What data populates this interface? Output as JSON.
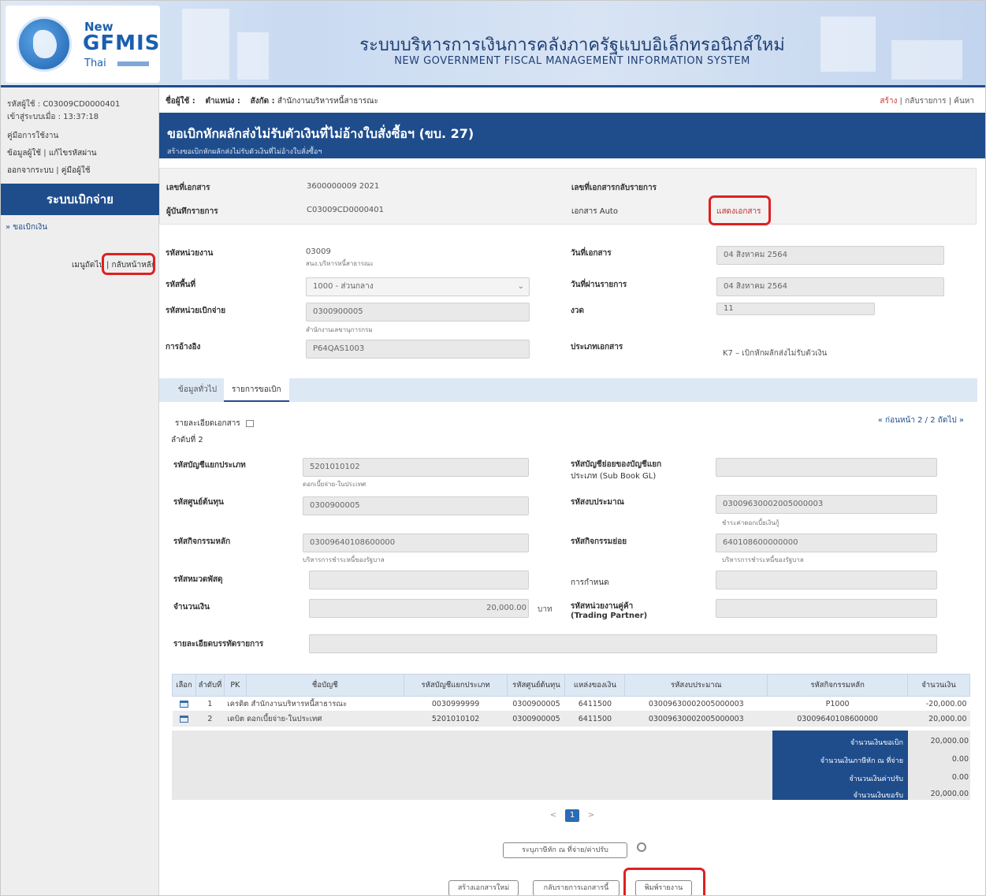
{
  "header": {
    "logo_new": "New",
    "logo_name": "GFMIS",
    "logo_thai": "Thai",
    "title_th": "ระบบบริหารการเงินการคลังภาครัฐแบบอิเล็กทรอนิกส์ใหม่",
    "title_en": "NEW GOVERNMENT FISCAL MANAGEMENT INFORMATION SYSTEM"
  },
  "sidebar": {
    "user_code": "รหัสผู้ใช้ : C03009CD0000401",
    "login_time": "เข้าสู่ระบบเมื่อ : 13:37:18",
    "manual": "คู่มือการใช้งาน",
    "user_info": "ข้อมูลผู้ใช้",
    "change_password": "แก้ไขรหัสผ่าน",
    "logout": "ออกจากระบบ",
    "user_manual": "คู่มือผู้ใช้",
    "system_name": "ระบบเบิกจ่าย",
    "menu_item": "» ขอเบิกเงิน",
    "nav_menu": "เมนูถัดไป",
    "nav_home": "กลับหน้าหลัก"
  },
  "topbar": {
    "user_label": "ชื่อผู้ใช้ :",
    "position_label": "ตำแหน่ง :",
    "affiliation_label": "สังกัด :",
    "affiliation_value": "สำนักงานบริหารหนี้สาธารณะ",
    "link_create": "สร้าง",
    "link_list": "กลับรายการ",
    "link_search": "ค้นหา"
  },
  "page": {
    "title": "ขอเบิกหักผลักส่งไม่รับตัวเงินที่ไม่อ้างใบสั่งซื้อฯ (ขบ. 27)",
    "subtitle": "สร้างขอเบิกหักผลักส่งไม่รับตัวเงินที่ไม่อ้างใบสั่งซื้อฯ"
  },
  "doc": {
    "doc_no_label": "เลขที่เอกสาร",
    "doc_no_value": "3600000009   2021",
    "recorder_label": "ผู้บันทึกรายการ",
    "recorder_value": "C03009CD0000401",
    "ref_doc_label": "เลขที่เอกสารกลับรายการ",
    "auto_doc_label": "เอกสาร Auto",
    "auto_doc_link": "แสดงเอกสาร"
  },
  "form": {
    "agency_label": "รหัสหน่วยงาน",
    "agency_value": "03009",
    "agency_sub": "สนง.บริหารหนี้สาธารณะ",
    "area_label": "รหัสพื้นที่",
    "area_value": "1000 - ส่วนกลาง",
    "disb_unit_label": "รหัสหน่วยเบิกจ่าย",
    "disb_unit_value": "0300900005",
    "disb_unit_sub": "สำนักงานเลขานุการกรม",
    "reference_label": "การอ้างอิง",
    "reference_value": "P64QAS1003",
    "doc_date_label": "วันที่เอกสาร",
    "doc_date_value": "04 สิงหาคม 2564",
    "post_date_label": "วันที่ผ่านรายการ",
    "post_date_value": "04 สิงหาคม 2564",
    "period_label": "งวด",
    "period_value": "11",
    "doc_type_label": "ประเภทเอกสาร",
    "doc_type_value": "K7 – เบิกหักผลักส่งไม่รับตัวเงิน"
  },
  "tabs": [
    "ข้อมูลทั่วไป",
    "รายการขอเบิก"
  ],
  "detail": {
    "header": "รายละเอียดเอกสาร",
    "pager": "« ก่อนหน้า 2 / 2 ถัดไป »",
    "item_no": "ลำดับที่ 2",
    "gl_label": "รหัสบัญชีแยกประเภท",
    "gl_value": "5201010102",
    "gl_sub": "ดอกเบี้ยจ่าย-ในประเทศ",
    "subgl_label": "รหัสบัญชีย่อยของบัญชีแยกประเภท (Sub Book GL)",
    "subgl_label1": "รหัสบัญชีย่อยของบัญชีแยก",
    "subgl_label2": "ประเภท (Sub Book GL)",
    "cost_center_label": "รหัสศูนย์ต้นทุน",
    "cost_center_value": "0300900005",
    "budget_label": "รหัสงบประมาณ",
    "budget_value": "03009630002005000003",
    "budget_sub": "ชำระค่าดอกเบี้ยเงินกู้",
    "main_activity_label": "รหัสกิจกรรมหลัก",
    "main_activity_value": "03009640108600000",
    "main_activity_sub": "บริหารการชำระหนี้ของรัฐบาล",
    "sub_activity_label": "รหัสกิจกรรมย่อย",
    "sub_activity_value": "640108600000000",
    "sub_activity_sub": "บริหารการชำระหนี้ของรัฐบาล",
    "asset_label": "รหัสหมวดพัสดุ",
    "designation_label": "การกำหนด",
    "amount_label": "จำนวนเงิน",
    "amount_value": "20,000.00",
    "amount_unit": "บาท",
    "trading_label1": "รหัสหน่วยงานคู่ค้า",
    "trading_label2": "(Trading Partner)",
    "desc_label": "รายละเอียดบรรทัดรายการ"
  },
  "table": {
    "columns": [
      "เลือก",
      "ลำดับที่",
      "PK",
      "ชื่อบัญชี",
      "รหัสบัญชีแยกประเภท",
      "รหัสศูนย์ต้นทุน",
      "แหล่งของเงิน",
      "รหัสงบประมาณ",
      "รหัสกิจกรรมหลัก",
      "จำนวนเงิน"
    ],
    "rows": [
      {
        "no": "1",
        "pk": "เครดิต",
        "account": "สำนักงานบริหารหนี้สาธารณะ",
        "gl": "0030999999",
        "cost_center": "0300900005",
        "fund": "6411500",
        "budget": "03009630002005000003",
        "activity": "P1000",
        "amount": "-20,000.00"
      },
      {
        "no": "2",
        "pk": "เดบิต",
        "account": "ดอกเบี้ยจ่าย-ในประเทศ",
        "gl": "5201010102",
        "cost_center": "0300900005",
        "fund": "6411500",
        "budget": "03009630002005000003",
        "activity": "03009640108600000",
        "amount": "20,000.00"
      }
    ]
  },
  "summary": {
    "requested_label": "จำนวนเงินขอเบิก",
    "requested_value": "20,000.00",
    "wht_label": "จำนวนเงินภาษีหัก ณ ที่จ่าย",
    "wht_value": "0.00",
    "fine_label": "จำนวนเงินค่าปรับ",
    "fine_value": "0.00",
    "net_label": "จำนวนเงินขอรับ",
    "net_value": "20,000.00"
  },
  "pager": {
    "prev": "<",
    "current": "1",
    "next": ">"
  },
  "buttons": {
    "wht": "ระบุภาษีหัก ณ ที่จ่าย/ค่าปรับ",
    "new_doc": "สร้างเอกสารใหม่",
    "reverse": "กลับรายการเอกสารนี้",
    "print": "พิมพ์รายงาน"
  }
}
